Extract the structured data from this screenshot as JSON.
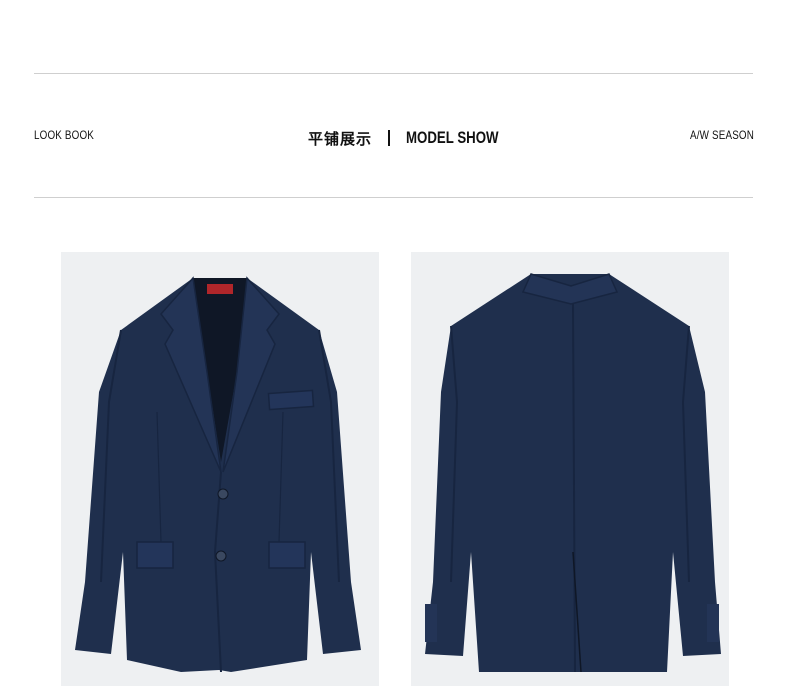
{
  "header": {
    "left_label": "LOOK BOOK",
    "center_cn": "平铺展示",
    "center_en": "MODEL SHOW",
    "right_label": "A/W SEASON"
  },
  "colors": {
    "jacket": "#1f2f4d",
    "jacket_shadow": "#172540",
    "lining": "#0f1726",
    "photo_bg": "#eef0f2",
    "rule": "#cfcfcf",
    "label_red": "#b0262a"
  }
}
